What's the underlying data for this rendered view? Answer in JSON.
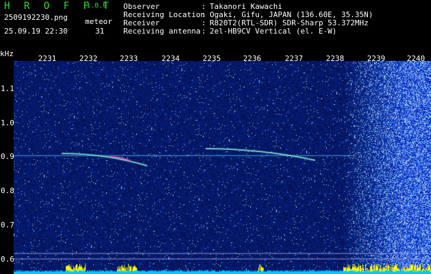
{
  "header": {
    "app_title": "H R O F F T",
    "app_version": "1.0.0",
    "file_name": "2509192230.png",
    "event_label": "meteor",
    "timestamp": "25.09.19 22:30",
    "event_count": "31"
  },
  "station_info": [
    {
      "label": "Observer",
      "value": "Takanori Kawachi"
    },
    {
      "label": "Receiving Location",
      "value": "Ogaki, Gifu, JAPAN (136.60E, 35.35N)"
    },
    {
      "label": "Receiver",
      "value": "R820T2(RTL-SDR) SDR-Sharp 53.372MHz"
    },
    {
      "label": "Receiving antenna",
      "value": "2el-HB9CV Vertical (el. E-W)"
    }
  ],
  "separator": ":",
  "spectrogram": {
    "unit_label": "kHz",
    "x_ticks": [
      "2231",
      "2232",
      "2233",
      "2234",
      "2235",
      "2236",
      "2237",
      "2238",
      "2239",
      "2240"
    ],
    "y_ticks": [
      "1.1",
      "1.0",
      "0.9",
      "0.8",
      "0.7",
      "0.6"
    ]
  },
  "colors": {
    "text_white": "#ffffff",
    "text_green": "#2fe02f",
    "background": "#000000",
    "noise_blue": "#1020a0",
    "level_bar": "#ffff00",
    "level_base": "#00c8ff"
  }
}
